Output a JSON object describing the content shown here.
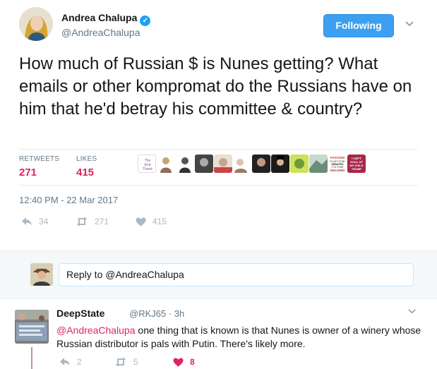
{
  "tweet": {
    "author_name": "Andrea Chalupa",
    "author_handle": "@AndreaChalupa",
    "follow_label": "Following",
    "text": "How much of Russian $ is Nunes getting? What emails or other kompromat do the Russians have on him that he'd betray his committee & country?",
    "retweets_label": "RETWEETS",
    "retweets_count": "271",
    "likes_label": "LIKES",
    "likes_count": "415",
    "timestamp": "12:40 PM - 22 Mar 2017",
    "actions": {
      "reply_count": "34",
      "retweet_count": "271",
      "like_count": "415"
    },
    "liker_badge_texts": [
      "FASCISM IS NOT TO BE DEBATED IT IS TO BE SMASHED",
      "I LEFT SOUL OF MY CHILDHOOD TRUMP"
    ]
  },
  "reply_box": {
    "placeholder": "Reply to @AndreaChalupa"
  },
  "reply": {
    "author_name": "DeepState",
    "author_handle": "@RKJ65",
    "time": "3h",
    "mention": "@AndreaChalupa",
    "text": " one thing that is known is that Nunes is owner of a winery whose Russian distributor is pals with Putin. There's likely more.",
    "reply_count": "2",
    "retweet_count": "5",
    "like_count": "8"
  },
  "colors": {
    "accent": "#1da1f2",
    "like": "#e0245e",
    "muted": "#657786",
    "follow_button": "#3d9ff0"
  }
}
